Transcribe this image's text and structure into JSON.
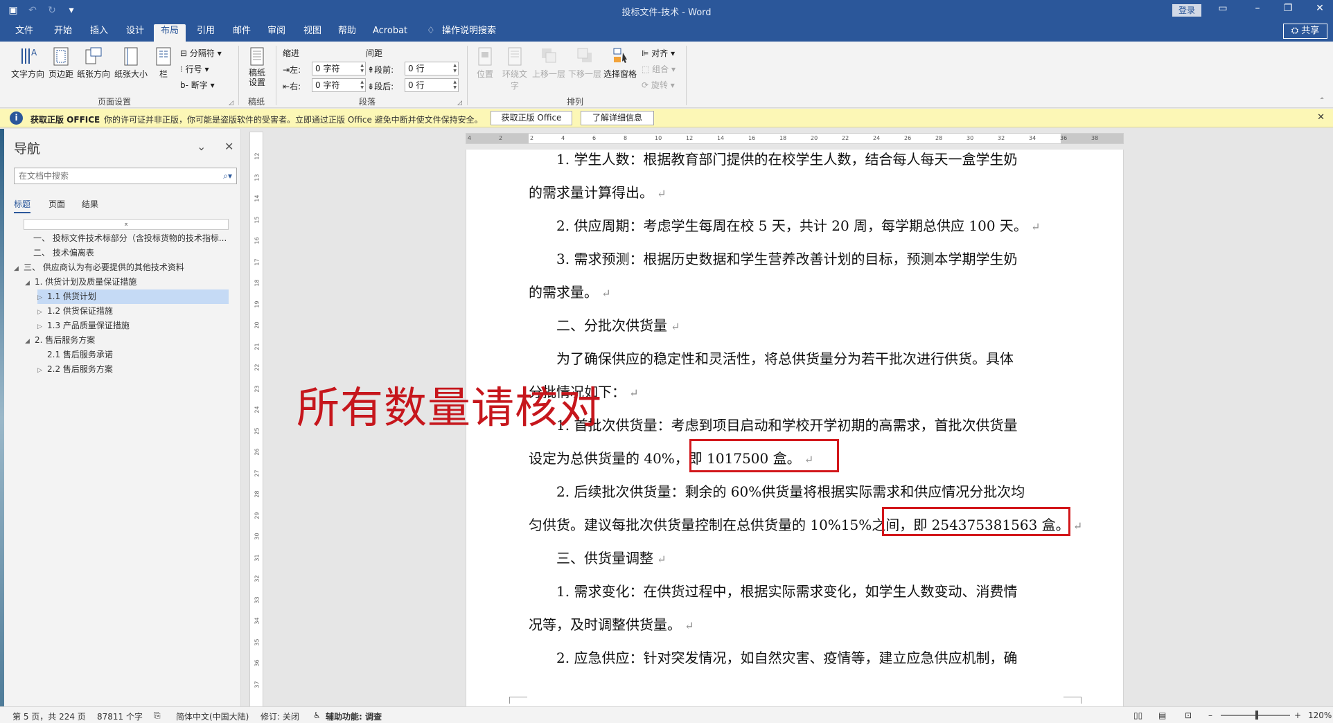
{
  "titlebar": {
    "title": "投标文件-技术  -  Word",
    "login": "登录",
    "save_icon": "save-icon",
    "undo_icon": "undo-icon",
    "redo_icon": "redo-icon"
  },
  "tabs": {
    "file": "文件",
    "home": "开始",
    "insert": "插入",
    "design": "设计",
    "layout": "布局",
    "references": "引用",
    "mailings": "邮件",
    "review": "审阅",
    "view": "视图",
    "help": "帮助",
    "acrobat": "Acrobat",
    "tellme": "操作说明搜索",
    "share": "共享"
  },
  "ribbon": {
    "text_direction": "文字方向",
    "margins": "页边距",
    "orientation": "纸张方向",
    "size": "纸张大小",
    "columns": "栏",
    "breaks": "分隔符",
    "line_numbers": "行号",
    "hyphenation": "断字",
    "page_setup_group": "页面设置",
    "draft_paper": "稿纸\n设置",
    "draft_group": "稿纸",
    "indent_label": "缩进",
    "spacing_label": "间距",
    "indent_left_label": "左:",
    "indent_right_label": "右:",
    "indent_left_value": "0 字符",
    "indent_right_value": "0 字符",
    "before_label": "段前:",
    "after_label": "段后:",
    "before_value": "0 行",
    "after_value": "0 行",
    "paragraph_group": "段落",
    "position": "位置",
    "wrap_text": "环绕文字",
    "bring_forward": "上移一层",
    "send_backward": "下移一层",
    "selection_pane": "选择窗格",
    "align": "对齐",
    "group": "组合",
    "rotate": "旋转",
    "arrange_group": "排列"
  },
  "message_bar": {
    "title": "获取正版 OFFICE",
    "text": "你的许可证并非正版，你可能是盗版软件的受害者。立即通过正版 Office 避免中断并使文件保持安全。",
    "get_genuine": "获取正版 Office",
    "learn_more": "了解详细信息"
  },
  "nav": {
    "title": "导航",
    "search_placeholder": "在文档中搜索",
    "tab_headings": "标题",
    "tab_pages": "页面",
    "tab_results": "结果",
    "items": [
      {
        "label": "一、 投标文件技术标部分（含投标货物的技术指标..."
      },
      {
        "label": "二、 技术偏离表"
      },
      {
        "label": "三、 供应商认为有必要提供的其他技术资料"
      },
      {
        "label": "1. 供货计划及质量保证措施"
      },
      {
        "label": "1.1 供货计划"
      },
      {
        "label": "1.2 供货保证措施"
      },
      {
        "label": "1.3 产品质量保证措施"
      },
      {
        "label": "2. 售后服务方案"
      },
      {
        "label": "2.1 售后服务承诺"
      },
      {
        "label": "2.2 售后服务方案"
      }
    ]
  },
  "ruler": {
    "h": [
      "4",
      "2",
      "2",
      "4",
      "6",
      "8",
      "10",
      "12",
      "14",
      "16",
      "18",
      "20",
      "22",
      "24",
      "26",
      "28",
      "30",
      "32",
      "34",
      "36",
      "38"
    ],
    "v": [
      "12",
      "13",
      "14",
      "15",
      "16",
      "17",
      "18",
      "19",
      "20",
      "21",
      "22",
      "23",
      "24",
      "25",
      "26",
      "27",
      "28",
      "29",
      "30",
      "31",
      "32",
      "33",
      "34",
      "35",
      "36",
      "37"
    ]
  },
  "document": {
    "lines": [
      "1. 学生人数：根据教育部门提供的在校学生人数，结合每人每天一盒学生奶",
      "的需求量计算得出。",
      "2. 供应周期：考虑学生每周在校 5 天，共计 20 周，每学期总供应 100 天。",
      "3. 需求预测：根据历史数据和学生营养改善计划的目标，预测本学期学生奶",
      "的需求量。",
      "二、分批次供货量",
      "为了确保供应的稳定性和灵活性，将总供货量分为若干批次进行供货。具体",
      "分批情况如下：",
      "1. 首批次供货量：考虑到项目启动和学校开学初期的高需求，首批次供货量",
      "设定为总供货量的 40%，即 1017500 盒。",
      "2. 后续批次供货量：剩余的 60%供货量将根据实际需求和供应情况分批次均",
      "匀供货。建议每批次供货量控制在总供货量的 10%15%之间，即 254375381563 盒。",
      "三、供货量调整",
      "1. 需求变化：在供货过程中，根据实际需求变化，如学生人数变动、消费情",
      "况等，及时调整供货量。",
      "2. 应急供应：针对突发情况，如自然灾害、疫情等，建立应急供应机制，确"
    ],
    "annotation": "所有数量请核对"
  },
  "status": {
    "page": "第 5 页，共 224 页",
    "words": "87811 个字",
    "language": "简体中文(中国大陆)",
    "track": "修订: 关闭",
    "accessibility": "辅助功能: 调查",
    "zoom": "120%"
  },
  "colors": {
    "brand": "#2b579a",
    "annotation_red": "#c6161c",
    "message_bar": "#fcf7b6"
  }
}
